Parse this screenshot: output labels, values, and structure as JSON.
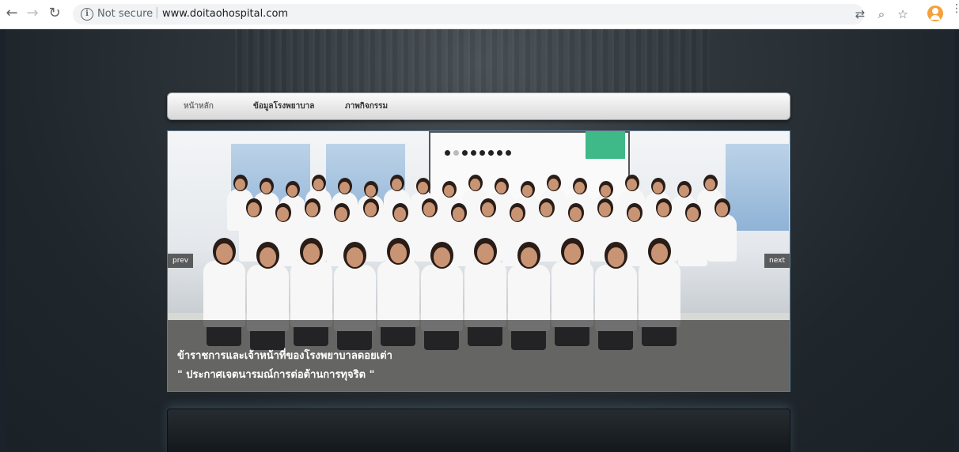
{
  "browser": {
    "security_label": "Not secure",
    "url": "www.doitaohospital.com"
  },
  "menu": {
    "items": [
      "หน้าหลัก",
      "ข้อมูลโรงพยาบาล",
      "ภาพกิจกรรม"
    ],
    "active_index": 0
  },
  "slider": {
    "dots_count": 8,
    "active_dot": 1,
    "prev_label": "prev",
    "next_label": "next",
    "caption_line1": "ข้าราชการและเจ้าหน้าที่ของโรงพยาบาลดอยเต่า",
    "caption_line2": "\" ประกาศเจตนารมณ์การต่อต้านการทุจริต \""
  },
  "colors": {
    "page_bg": "#2e353b",
    "menu_bg": "#e8e8e8",
    "caption_overlay": "#282828"
  }
}
